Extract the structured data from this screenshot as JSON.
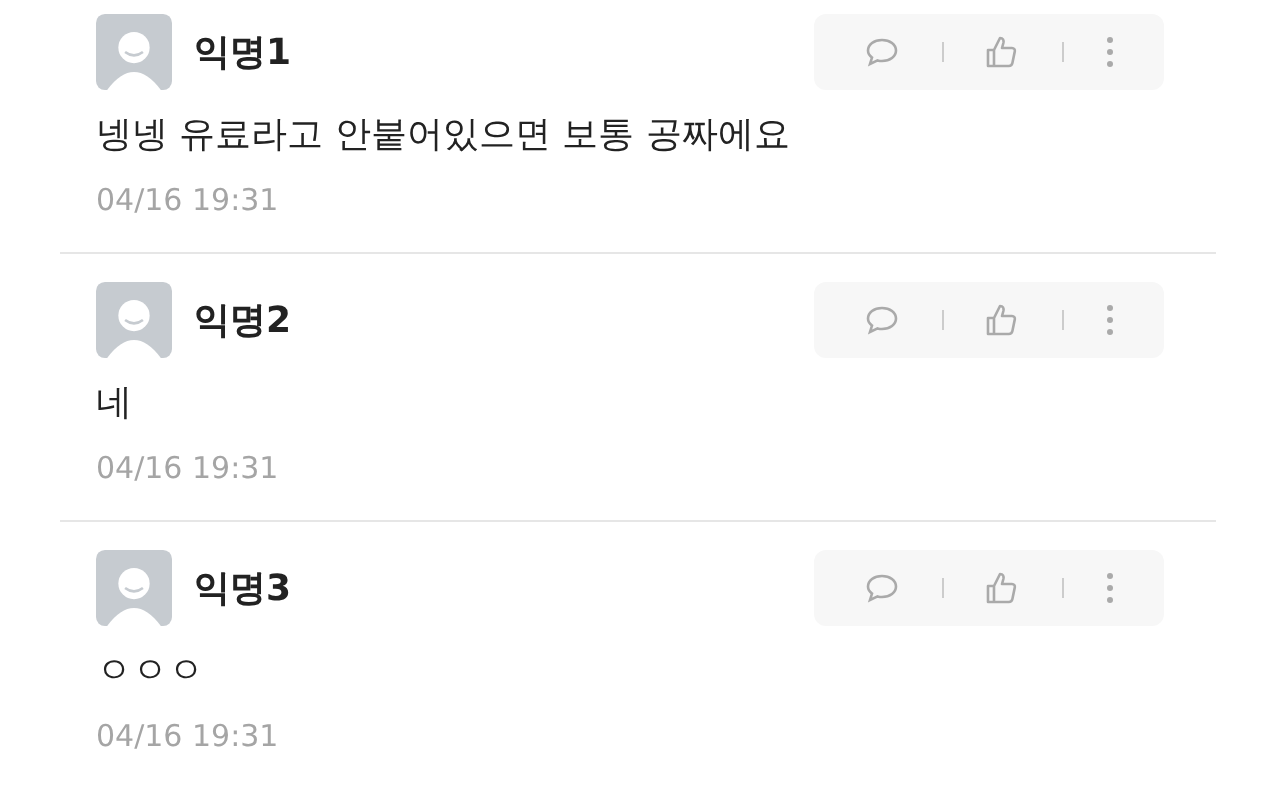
{
  "comments": [
    {
      "author": "익명1",
      "text": "넹넹 유료라고 안붙어있으면 보통 공짜에요",
      "time": "04/16 19:31"
    },
    {
      "author": "익명2",
      "text": "네",
      "time": "04/16 19:31"
    },
    {
      "author": "익명3",
      "text": "ㅇㅇㅇ",
      "time": "04/16 19:31"
    }
  ]
}
